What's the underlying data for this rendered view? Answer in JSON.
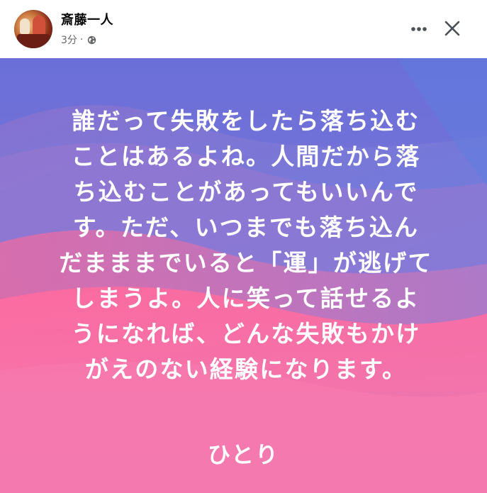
{
  "post": {
    "author": "斎藤一人",
    "time": "3分",
    "separator": "·",
    "privacy_icon": "globe-icon",
    "more_icon": "more-horizontal-icon",
    "close_icon": "close-icon"
  },
  "card": {
    "lines": [
      "誰だって失敗をしたら落ち込む",
      "ことはあるよね。人間だから落",
      "ち込むことがあってもいいんで",
      "す。ただ、いつまでも落ち込ん",
      "だまままでいると「運」が逃げて",
      "しまうよ。人に笑って話せるよ",
      "うになれば、どんな失敗もかけ",
      "がえのない経験になります。"
    ],
    "signature": "ひとり"
  },
  "colors": {
    "text_primary": "#050505",
    "text_secondary": "#65676b",
    "card_top": "#6c6fd6",
    "card_bottom": "#f374ab"
  }
}
